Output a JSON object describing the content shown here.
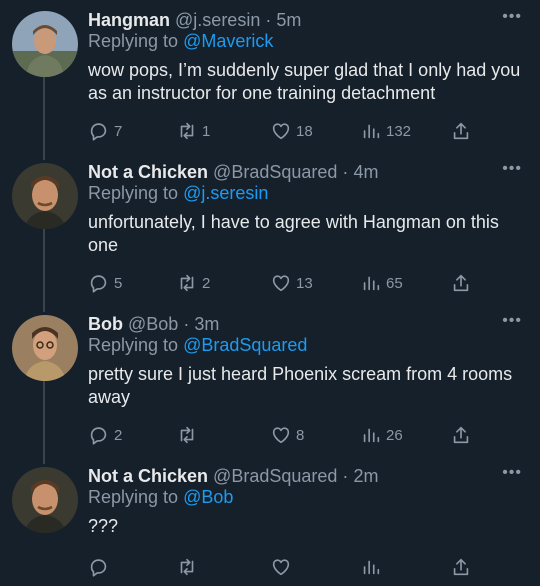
{
  "colors": {
    "background": "#15202b",
    "text": "#e7e9ea",
    "muted": "#8b98a5",
    "link": "#1d9bf0"
  },
  "replying_prefix": "Replying to",
  "tweets": [
    {
      "name": "Hangman",
      "handle": "@j.seresin",
      "dot": "·",
      "time": "5m",
      "replying_to": "@Maverick",
      "text": "wow pops, I’m suddenly super glad that I only had you as an instructor for one training detachment",
      "replies": "7",
      "retweets": "1",
      "likes": "18",
      "views": "132"
    },
    {
      "name": "Not a Chicken",
      "handle": "@BradSquared",
      "dot": "·",
      "time": "4m",
      "replying_to": "@j.seresin",
      "text": "unfortunately, I have to agree with Hangman on this one",
      "replies": "5",
      "retweets": "2",
      "likes": "13",
      "views": "65"
    },
    {
      "name": "Bob",
      "handle": "@Bob",
      "dot": "·",
      "time": "3m",
      "replying_to": "@BradSquared",
      "text": "pretty sure I just heard Phoenix scream from 4 rooms away",
      "replies": "2",
      "retweets": "",
      "likes": "8",
      "views": "26"
    },
    {
      "name": "Not a Chicken",
      "handle": "@BradSquared",
      "dot": "·",
      "time": "2m",
      "replying_to": "@Bob",
      "text": "???",
      "replies": "",
      "retweets": "",
      "likes": "",
      "views": ""
    }
  ],
  "icons": {
    "reply": "reply-icon",
    "retweet": "retweet-icon",
    "like": "heart-icon",
    "views": "views-icon",
    "share": "share-icon",
    "more": "more-icon"
  }
}
